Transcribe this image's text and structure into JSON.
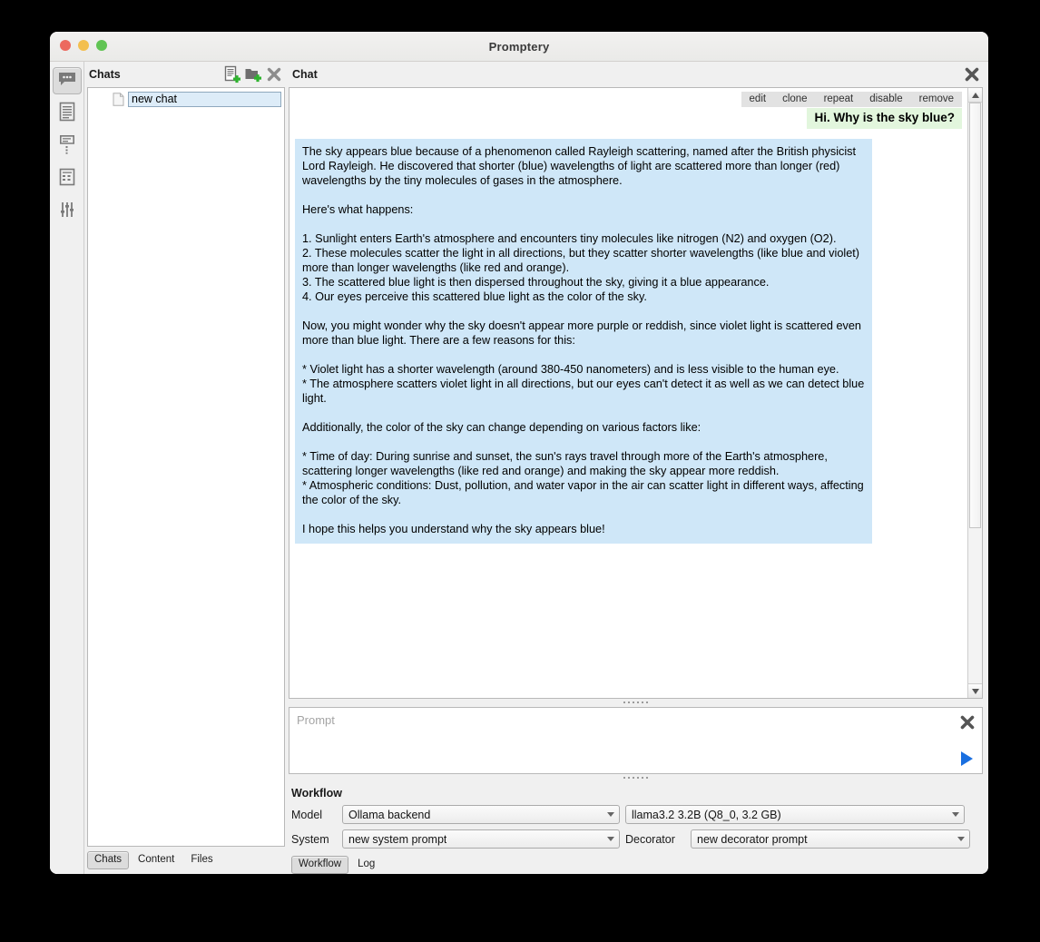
{
  "window": {
    "title": "Promptery",
    "traffic_lights": [
      "close-button",
      "minimize-button",
      "maximize-button"
    ]
  },
  "rail": {
    "items": [
      {
        "icon": "chat-bubble-icon",
        "name": "rail-item-chats",
        "active": true
      },
      {
        "icon": "document-icon",
        "name": "rail-item-content",
        "active": false
      },
      {
        "icon": "document-list-icon",
        "name": "rail-item-notes",
        "active": false
      },
      {
        "icon": "table-icon",
        "name": "rail-item-data",
        "active": false
      },
      {
        "icon": "sliders-icon",
        "name": "rail-item-settings",
        "active": false
      }
    ]
  },
  "chats_panel": {
    "title": "Chats",
    "tools": [
      {
        "icon": "new-chat-icon",
        "label": "New chat"
      },
      {
        "icon": "new-folder-icon",
        "label": "New folder"
      },
      {
        "icon": "delete-icon",
        "label": "Delete"
      }
    ],
    "items": [
      {
        "icon": "document-icon",
        "name": "new chat",
        "editing": true
      }
    ],
    "tabs": [
      {
        "label": "Chats",
        "selected": true
      },
      {
        "label": "Content",
        "selected": false
      },
      {
        "label": "Files",
        "selected": false
      }
    ]
  },
  "chat_panel": {
    "title": "Chat",
    "close_icon": "close-icon",
    "message_actions": [
      "edit",
      "clone",
      "repeat",
      "disable",
      "remove"
    ],
    "user_message": "Hi. Why is the sky blue?",
    "assistant_message": "The sky appears blue because of a phenomenon called Rayleigh scattering, named after the British physicist Lord Rayleigh. He discovered that shorter (blue) wavelengths of light are scattered more than longer (red) wavelengths by the tiny molecules of gases in the atmosphere.\n\nHere's what happens:\n\n1. Sunlight enters Earth's atmosphere and encounters tiny molecules like nitrogen (N2) and oxygen (O2).\n2. These molecules scatter the light in all directions, but they scatter shorter wavelengths (like blue and violet) more than longer wavelengths (like red and orange).\n3. The scattered blue light is then dispersed throughout the sky, giving it a blue appearance.\n4. Our eyes perceive this scattered blue light as the color of the sky.\n\nNow, you might wonder why the sky doesn't appear more purple or reddish, since violet light is scattered even more than blue light. There are a few reasons for this:\n\n* Violet light has a shorter wavelength (around 380-450 nanometers) and is less visible to the human eye.\n* The atmosphere scatters violet light in all directions, but our eyes can't detect it as well as we can detect blue light.\n\nAdditionally, the color of the sky can change depending on various factors like:\n\n* Time of day: During sunrise and sunset, the sun's rays travel through more of the Earth's atmosphere, scattering longer wavelengths (like red and orange) and making the sky appear more reddish.\n* Atmospheric conditions: Dust, pollution, and water vapor in the air can scatter light in different ways, affecting the color of the sky.\n\nI hope this helps you understand why the sky appears blue!"
  },
  "prompt": {
    "placeholder": "Prompt",
    "value": "",
    "clear_icon": "close-icon",
    "send_icon": "send-play-icon"
  },
  "workflow": {
    "title": "Workflow",
    "model_label": "Model",
    "backend_value": "Ollama backend",
    "model_value": "llama3.2 3.2B (Q8_0, 3.2 GB)",
    "system_label": "System",
    "system_value": "new system prompt",
    "decorator_label": "Decorator",
    "decorator_value": "new decorator prompt",
    "tabs": [
      {
        "label": "Workflow",
        "selected": true
      },
      {
        "label": "Log",
        "selected": false
      }
    ]
  },
  "colors": {
    "user_bubble": "#e2f6dd",
    "assistant_bubble": "#cfe7f8",
    "accent_green": "#2fb32f",
    "send_blue": "#1a6fe0",
    "window_bg": "#f0f0f0"
  }
}
